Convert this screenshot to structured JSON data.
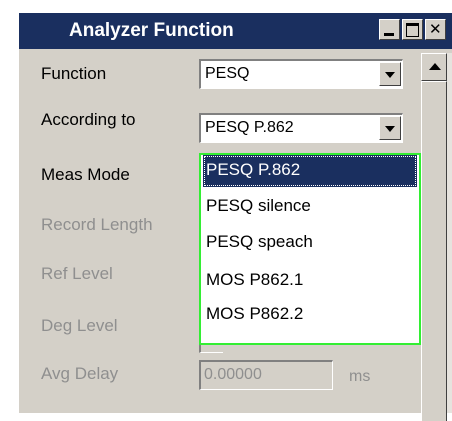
{
  "window": {
    "title": "Analyzer Function",
    "buttons": [
      "minimize-icon",
      "maximize-icon",
      "close-icon"
    ]
  },
  "rows": [
    {
      "label": "Function",
      "value": "PESQ",
      "enabled": true
    },
    {
      "label": "According to",
      "value": "PESQ P.862",
      "enabled": true
    },
    {
      "label": "Meas Mode",
      "enabled": true
    },
    {
      "label": "Record Length",
      "enabled": false
    },
    {
      "label": "Ref Level",
      "enabled": false
    },
    {
      "label": "Deg Level",
      "enabled": false
    },
    {
      "label": "Avg Delay",
      "value": "0.00000",
      "unit": "ms",
      "enabled": false
    }
  ],
  "dropdown": {
    "options": [
      "PESQ P.862",
      "PESQ silence",
      "PESQ speach",
      "MOS P862.1",
      "MOS P862.2"
    ],
    "selected": "PESQ P.862"
  },
  "colors": {
    "titlebar": "#1a2f5f",
    "panel": "#d4d0c8",
    "dropdown_border": "#33ee33",
    "disabled_text": "#8f8f8f"
  }
}
